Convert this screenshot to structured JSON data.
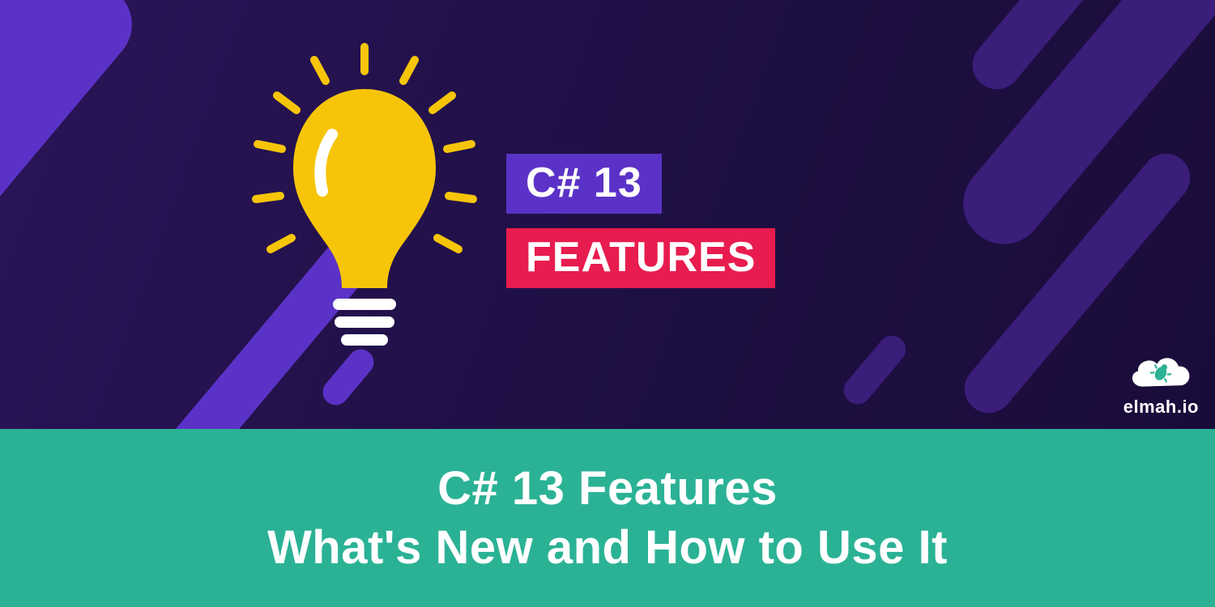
{
  "hero": {
    "badge1": "C# 13",
    "badge2": "FEATURES",
    "logo_text": "elmah.io"
  },
  "footer": {
    "line1": "C# 13 Features",
    "line2": "What's New and How to Use It"
  },
  "colors": {
    "hero_bg_start": "#2a1458",
    "hero_bg_end": "#1a0c3a",
    "stripe_purple": "#5b32c7",
    "stripe_darkpurple": "#3b1d7a",
    "badge_purple": "#5b32c7",
    "badge_red": "#e81c4f",
    "bulb_yellow": "#f6c509",
    "footer_teal": "#2bb295"
  }
}
